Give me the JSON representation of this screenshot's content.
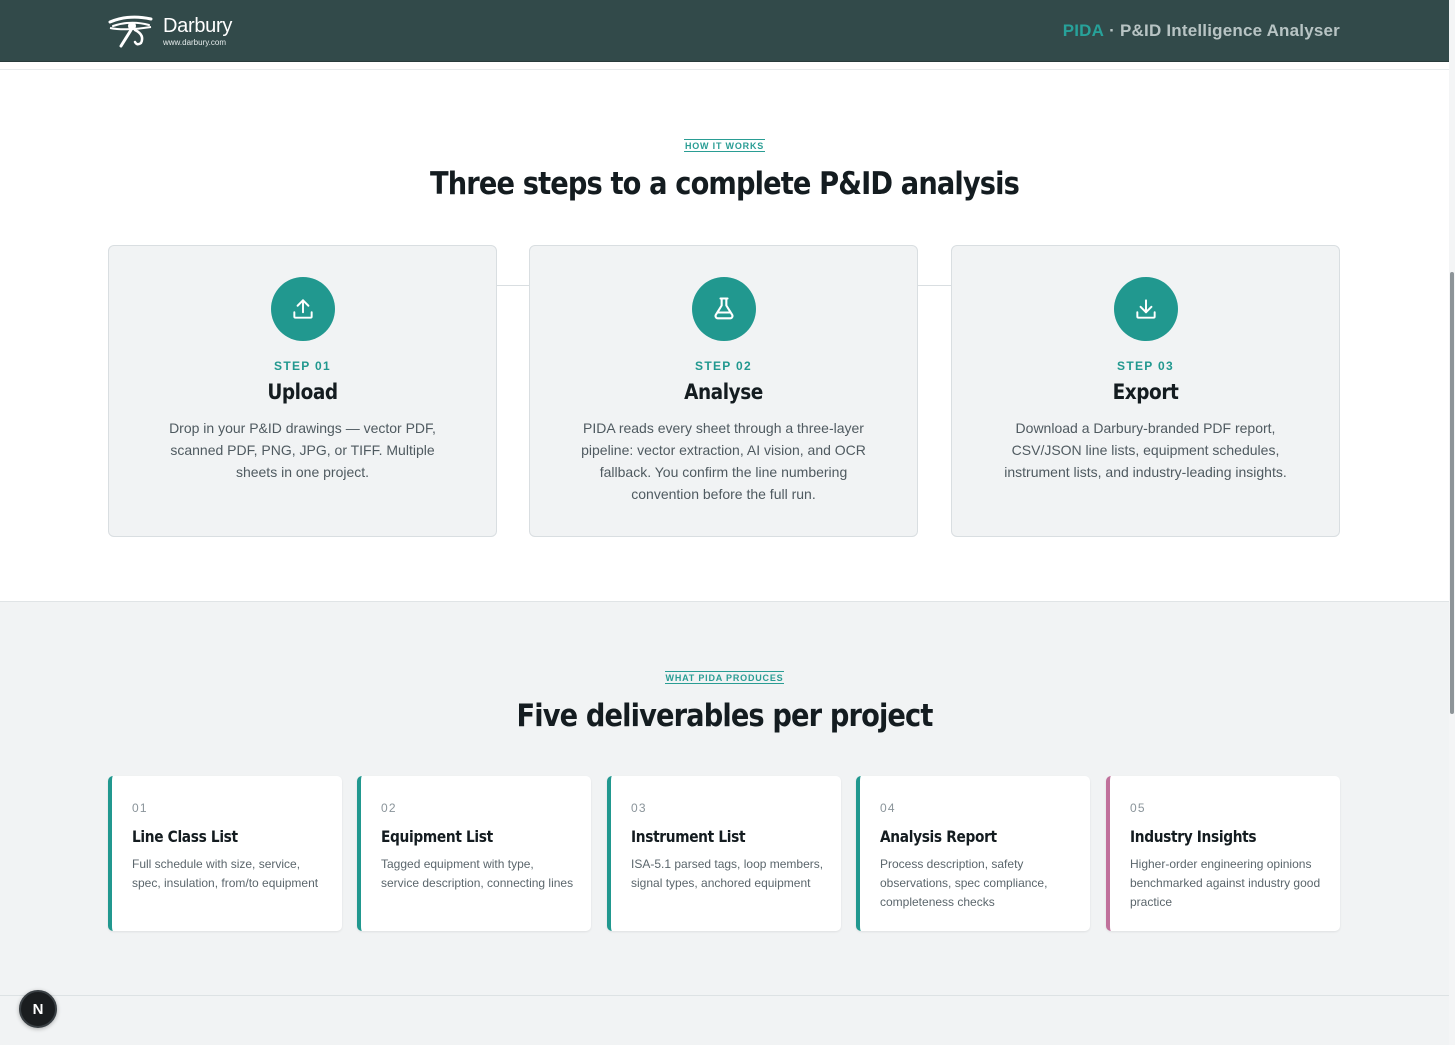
{
  "header": {
    "logo_name": "Darbury",
    "logo_url": "www.darbury.com",
    "brand": "PIDA",
    "separator": "·",
    "app_title": "P&ID Intelligence Analyser"
  },
  "how_it_works": {
    "eyebrow": "HOW IT WORKS",
    "title": "Three steps to a complete P&ID analysis",
    "steps": [
      {
        "label": "STEP 01",
        "title": "Upload",
        "icon": "upload-icon",
        "description": "Drop in your P&ID drawings — vector PDF, scanned PDF, PNG, JPG, or TIFF. Multiple sheets in one project."
      },
      {
        "label": "STEP 02",
        "title": "Analyse",
        "icon": "flask-icon",
        "description": "PIDA reads every sheet through a three-layer pipeline: vector extraction, AI vision, and OCR fallback. You confirm the line numbering convention before the full run."
      },
      {
        "label": "STEP 03",
        "title": "Export",
        "icon": "download-icon",
        "description": "Download a Darbury-branded PDF report, CSV/JSON line lists, equipment schedules, instrument lists, and industry-leading insights."
      }
    ]
  },
  "deliverables": {
    "eyebrow": "WHAT PIDA PRODUCES",
    "title": "Five deliverables per project",
    "items": [
      {
        "num": "01",
        "title": "Line Class List",
        "description": "Full schedule with size, service, spec, insulation, from/to equipment",
        "accent": "#21988f"
      },
      {
        "num": "02",
        "title": "Equipment List",
        "description": "Tagged equipment with type, service description, connecting lines",
        "accent": "#21988f"
      },
      {
        "num": "03",
        "title": "Instrument List",
        "description": "ISA-5.1 parsed tags, loop members, signal types, anchored equipment",
        "accent": "#21988f"
      },
      {
        "num": "04",
        "title": "Analysis Report",
        "description": "Process description, safety observations, spec compliance, completeness checks",
        "accent": "#21988f"
      },
      {
        "num": "05",
        "title": "Industry Insights",
        "description": "Higher-order engineering opinions benchmarked against industry good practice",
        "accent": "#c0719b"
      }
    ]
  },
  "badge": {
    "letter": "N"
  },
  "colors": {
    "header_bg": "#324a4a",
    "accent": "#21988f",
    "pink_accent": "#c0719b"
  }
}
